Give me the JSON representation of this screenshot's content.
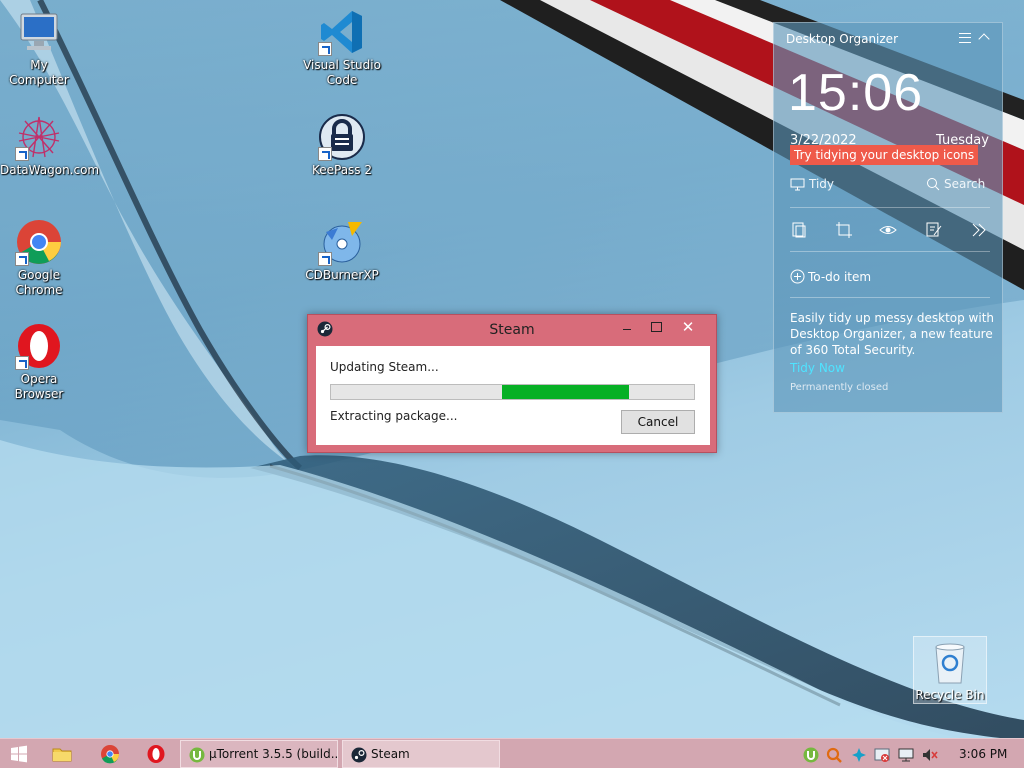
{
  "desktop": {
    "icons": [
      {
        "label": "My Computer",
        "icon": "computer-icon"
      },
      {
        "label": "DataWagon.com",
        "icon": "datawagon-icon"
      },
      {
        "label": "Google Chrome",
        "icon": "chrome-icon"
      },
      {
        "label": "Opera Browser",
        "icon": "opera-icon"
      },
      {
        "label": "Visual Studio Code",
        "icon": "vscode-icon"
      },
      {
        "label": "KeePass 2",
        "icon": "keepass-icon"
      },
      {
        "label": "CDBurnerXP",
        "icon": "cdburner-icon"
      }
    ],
    "recycle_bin": "Recycle Bin"
  },
  "organizer": {
    "title": "Desktop Organizer",
    "time": "15:06",
    "date": "3/22/2022",
    "day": "Tuesday",
    "tip": "Try tidying your desktop icons",
    "tidy": "Tidy",
    "search": "Search",
    "todo": "To-do item",
    "description": "Easily tidy up messy desktop with Desktop Organizer, a new feature of 360 Total Security.",
    "tidy_now": "Tidy Now",
    "permanently_closed": "Permanently closed",
    "accent": "#4fe3ff"
  },
  "steam": {
    "title": "Steam",
    "status": "Updating Steam...",
    "substatus": "Extracting package...",
    "cancel": "Cancel",
    "close": "✕",
    "progress": {
      "start": 0.47,
      "end": 0.82
    },
    "progress_color": "#06b025",
    "frame_color": "#d86c7a"
  },
  "taskbar": {
    "tasks": [
      {
        "label": "µTorrent 3.5.5  (build..."
      },
      {
        "label": "Steam"
      }
    ],
    "clock": "3:06 PM",
    "color": "#d3a7b1"
  }
}
